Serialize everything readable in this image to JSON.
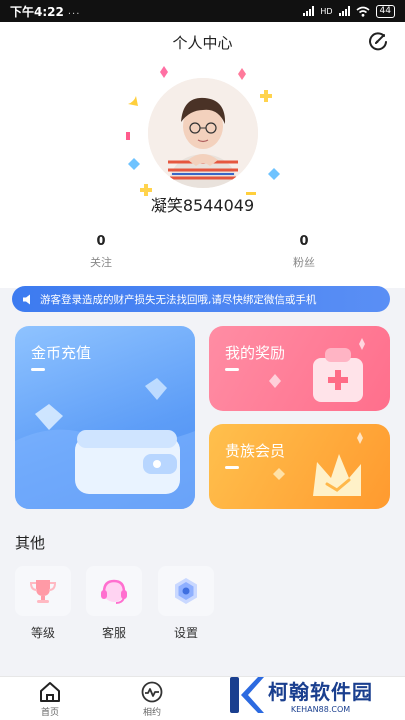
{
  "status_bar": {
    "time": "下午4:22",
    "dots": "...",
    "network": "HD",
    "battery": "44"
  },
  "header": {
    "title": "个人中心",
    "username": "凝笑8544049",
    "stats": [
      {
        "value": "0",
        "label": "关注"
      },
      {
        "value": "0",
        "label": "粉丝"
      }
    ]
  },
  "notice": {
    "text": "游客登录造成的财产损失无法找回哦,请尽快绑定微信或手机"
  },
  "cards": {
    "gold": {
      "title": "金币充值"
    },
    "reward": {
      "title": "我的奖励"
    },
    "noble": {
      "title": "贵族会员"
    }
  },
  "other": {
    "title": "其他",
    "items": [
      {
        "label": "等级",
        "icon": "trophy-icon"
      },
      {
        "label": "客服",
        "icon": "headset-icon"
      },
      {
        "label": "设置",
        "icon": "settings-icon"
      }
    ]
  },
  "tabbar": {
    "items": [
      {
        "label": "首页",
        "icon": "home-icon"
      },
      {
        "label": "相约",
        "icon": "activity-icon"
      }
    ]
  },
  "watermark": {
    "name": "柯翰软件园",
    "url": "KEHAN88.COM"
  },
  "colors": {
    "notice": "#3d7bf0",
    "gold_card": "#5d9df7",
    "reward_card": "#ff7391",
    "noble_card": "#ffa83a",
    "watermark": "#1a3f8f"
  }
}
